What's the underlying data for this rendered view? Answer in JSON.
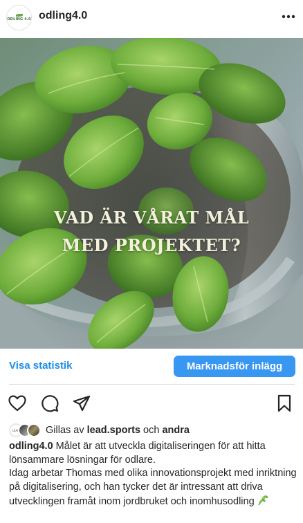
{
  "header": {
    "username": "odling4.0",
    "avatar_logo": "ODLING 4.0",
    "more_icon": "more-horizontal-icon"
  },
  "post": {
    "overlay_line1": "VAD ÄR VÅRAT MÅL",
    "overlay_line2": "MED PROJEKTET?",
    "image_subject": "basil plant in a grey flower pot"
  },
  "insights": {
    "stats_label": "Visa statistik",
    "promote_label": "Marknadsför inlägg"
  },
  "actions": {
    "like_icon": "heart-icon",
    "comment_icon": "comment-icon",
    "share_icon": "send-icon",
    "save_icon": "bookmark-icon"
  },
  "likes": {
    "prefix": "Gillas av ",
    "user": "lead.sports",
    "conj": " och ",
    "others": "andra",
    "avatar1_text": "LEAD"
  },
  "caption": {
    "username": "odling4.0",
    "line1": " Målet är att utveckla digitaliseringen för att hitta lönsammare lösningar för odlare.",
    "line2": "Idag arbetar Thomas med olika innovationsprojekt med inriktning på digitalisering, och han tycker det är intressant att driva utvecklingen framåt inom jordbruket och inomhusodling",
    "emoji": "herb-emoji"
  },
  "colors": {
    "accent": "#3897f0",
    "link": "#1e8ee5",
    "text": "#262626",
    "divider": "#dbdbdb"
  }
}
